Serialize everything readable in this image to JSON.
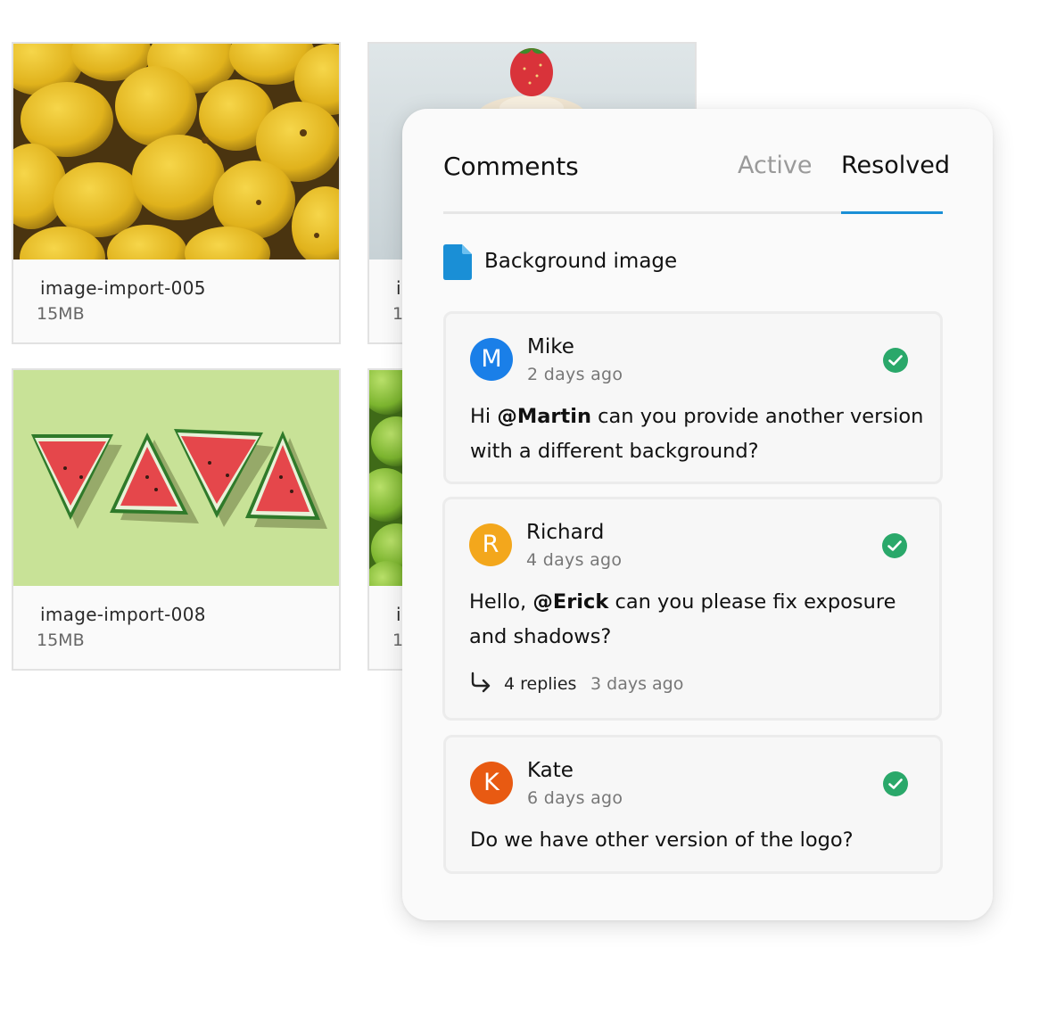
{
  "assets": [
    {
      "name": "image-import-005",
      "size": "15MB"
    },
    {
      "name": "i",
      "size": "1"
    },
    {
      "name": "image-import-008",
      "size": "15MB"
    },
    {
      "name": "i",
      "size": "1"
    }
  ],
  "comments_panel": {
    "title": "Comments",
    "tabs": [
      {
        "label": "Active",
        "selected": false
      },
      {
        "label": "Resolved",
        "selected": true
      }
    ],
    "document": {
      "icon": "file-icon",
      "label": "Background image"
    },
    "items": [
      {
        "initial": "M",
        "avatar_color": "#1a7fe8",
        "author": "Mike",
        "time": "2 days ago",
        "text_prefix": "Hi ",
        "mention": "@Martin",
        "text_suffix": " can you provide another version with a different background?",
        "status_icon": "check-circle-icon"
      },
      {
        "initial": "R",
        "avatar_color": "#f3a71c",
        "author": "Richard",
        "time": "4 days ago",
        "text_prefix": "Hello, ",
        "mention": "@Erick",
        "text_suffix": " can you please fix exposure and shadows?",
        "replies": "4 replies",
        "replies_time": "3 days ago",
        "status_icon": "check-circle-icon"
      },
      {
        "initial": "K",
        "avatar_color": "#e85a12",
        "author": "Kate",
        "time": "6 days ago",
        "text": "Do we have other version of the logo?",
        "status_icon": "check-circle-icon"
      }
    ]
  },
  "colors": {
    "accent": "#1a8fd6",
    "resolved_check": "#2aa86a",
    "file_icon": "#1a8fd6"
  }
}
